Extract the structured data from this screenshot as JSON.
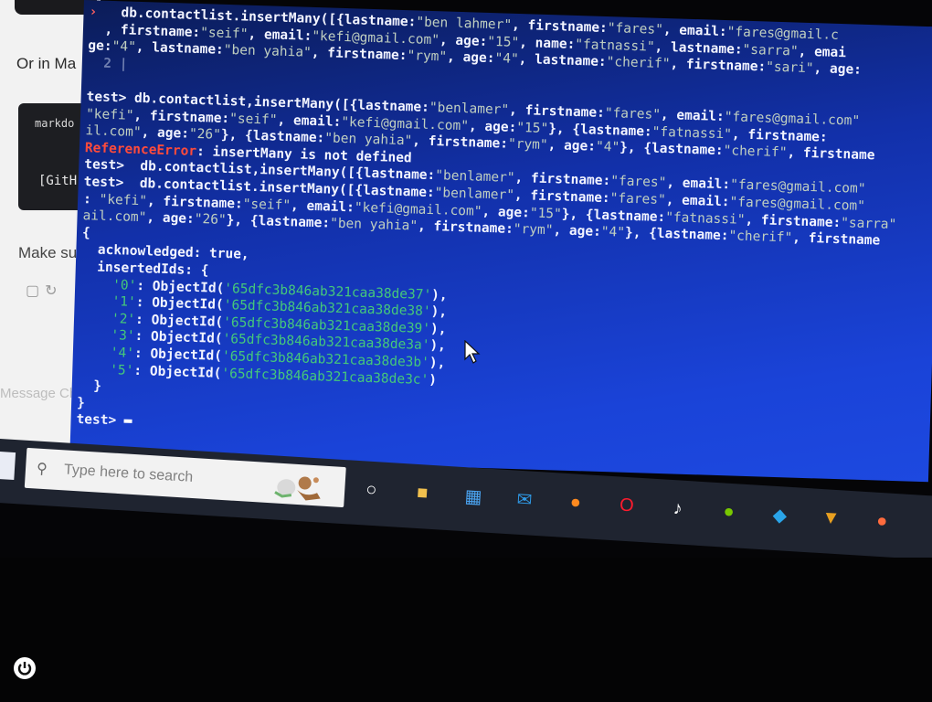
{
  "background_window": {
    "or_text": "Or in Ma",
    "markdown_text": "markdo",
    "github_text": "[GitH",
    "make_text": "Make su",
    "message_text": "Message Ch"
  },
  "terminal": {
    "lines": [
      {
        "segments": [
          {
            "t": "› ",
            "c": "caret"
          },
          {
            "t": "  db.contactlist.insertMany([{lastname:"
          },
          {
            "t": "\"ben lahmer\"",
            "c": "s"
          },
          {
            "t": ", firstname:"
          },
          {
            "t": "\"fares\"",
            "c": "s"
          },
          {
            "t": ", email:"
          },
          {
            "t": "\"fares@gmail.c",
            "c": "s"
          }
        ]
      },
      {
        "segments": [
          {
            "t": "  , firstname:"
          },
          {
            "t": "\"seif\"",
            "c": "s"
          },
          {
            "t": ", email:"
          },
          {
            "t": "\"kefi@gmail.com\"",
            "c": "s"
          },
          {
            "t": ", age:"
          },
          {
            "t": "\"15\"",
            "c": "s"
          },
          {
            "t": ", name:"
          },
          {
            "t": "\"fatnassi\"",
            "c": "s"
          },
          {
            "t": ", lastname:"
          },
          {
            "t": "\"sarra\"",
            "c": "s"
          },
          {
            "t": ", emai"
          }
        ]
      },
      {
        "segments": [
          {
            "t": "ge:"
          },
          {
            "t": "\"4\"",
            "c": "s"
          },
          {
            "t": ", lastname:"
          },
          {
            "t": "\"ben yahia\"",
            "c": "s"
          },
          {
            "t": ", firstname:"
          },
          {
            "t": "\"rym\"",
            "c": "s"
          },
          {
            "t": ", age:"
          },
          {
            "t": "\"4\"",
            "c": "s"
          },
          {
            "t": ", lastname:"
          },
          {
            "t": "\"cherif\"",
            "c": "s"
          },
          {
            "t": ", firstname:"
          },
          {
            "t": "\"sari\"",
            "c": "s"
          },
          {
            "t": ", age:"
          }
        ]
      },
      {
        "segments": [
          {
            "t": "  2 |",
            "c": "gutter"
          }
        ]
      },
      {
        "segments": [
          {
            "t": ""
          }
        ]
      },
      {
        "segments": [
          {
            "t": "test> db.contactlist,insertMany([{lastname:"
          },
          {
            "t": "\"benlamer\"",
            "c": "s"
          },
          {
            "t": ", firstname:"
          },
          {
            "t": "\"fares\"",
            "c": "s"
          },
          {
            "t": ", email:"
          },
          {
            "t": "\"fares@gmail.com\"",
            "c": "s"
          }
        ]
      },
      {
        "segments": [
          {
            "t": "\"kefi\"",
            "c": "s"
          },
          {
            "t": ", firstname:"
          },
          {
            "t": "\"seif\"",
            "c": "s"
          },
          {
            "t": ", email:"
          },
          {
            "t": "\"kefi@gmail.com\"",
            "c": "s"
          },
          {
            "t": ", age:"
          },
          {
            "t": "\"15\"",
            "c": "s"
          },
          {
            "t": "}, {lastname:"
          },
          {
            "t": "\"fatnassi\"",
            "c": "s"
          },
          {
            "t": ", firstname:"
          }
        ]
      },
      {
        "segments": [
          {
            "t": "il.com\"",
            "c": "s"
          },
          {
            "t": ", age:"
          },
          {
            "t": "\"26\"",
            "c": "s"
          },
          {
            "t": "}, {lastname:"
          },
          {
            "t": "\"ben yahia\"",
            "c": "s"
          },
          {
            "t": ", firstname:"
          },
          {
            "t": "\"rym\"",
            "c": "s"
          },
          {
            "t": ", age:"
          },
          {
            "t": "\"4\"",
            "c": "s"
          },
          {
            "t": "}, {lastname:"
          },
          {
            "t": "\"cherif\"",
            "c": "s"
          },
          {
            "t": ", firstname"
          }
        ]
      },
      {
        "segments": [
          {
            "t": "ReferenceError",
            "c": "err"
          },
          {
            "t": ": insertMany is not defined"
          }
        ]
      },
      {
        "segments": [
          {
            "t": "test>  db.contactlist,insertMany([{lastname:"
          },
          {
            "t": "\"benlamer\"",
            "c": "s"
          },
          {
            "t": ", firstname:"
          },
          {
            "t": "\"fares\"",
            "c": "s"
          },
          {
            "t": ", email:"
          },
          {
            "t": "\"fares@gmail.com\"",
            "c": "s"
          }
        ]
      },
      {
        "segments": [
          {
            "t": "test>  db.contactlist.insertMany([{lastname:"
          },
          {
            "t": "\"benlamer\"",
            "c": "s"
          },
          {
            "t": ", firstname:"
          },
          {
            "t": "\"fares\"",
            "c": "s"
          },
          {
            "t": ", email:"
          },
          {
            "t": "\"fares@gmail.com\"",
            "c": "s"
          }
        ]
      },
      {
        "segments": [
          {
            "t": ": "
          },
          {
            "t": "\"kefi\"",
            "c": "s"
          },
          {
            "t": ", firstname:"
          },
          {
            "t": "\"seif\"",
            "c": "s"
          },
          {
            "t": ", email:"
          },
          {
            "t": "\"kefi@gmail.com\"",
            "c": "s"
          },
          {
            "t": ", age:"
          },
          {
            "t": "\"15\"",
            "c": "s"
          },
          {
            "t": "}, {lastname:"
          },
          {
            "t": "\"fatnassi\"",
            "c": "s"
          },
          {
            "t": ", firstname:"
          },
          {
            "t": "\"sarra\"",
            "c": "s"
          }
        ]
      },
      {
        "segments": [
          {
            "t": "ail.com\"",
            "c": "s"
          },
          {
            "t": ", age:"
          },
          {
            "t": "\"26\"",
            "c": "s"
          },
          {
            "t": "}, {lastname:"
          },
          {
            "t": "\"ben yahia\"",
            "c": "s"
          },
          {
            "t": ", firstname:"
          },
          {
            "t": "\"rym\"",
            "c": "s"
          },
          {
            "t": ", age:"
          },
          {
            "t": "\"4\"",
            "c": "s"
          },
          {
            "t": "}, {lastname:"
          },
          {
            "t": "\"cherif\"",
            "c": "s"
          },
          {
            "t": ", firstname"
          }
        ]
      },
      {
        "segments": [
          {
            "t": "{"
          }
        ]
      },
      {
        "segments": [
          {
            "t": "  acknowledged: true,"
          }
        ]
      },
      {
        "segments": [
          {
            "t": "  insertedIds: {"
          }
        ]
      },
      {
        "segments": [
          {
            "t": "    "
          },
          {
            "t": "'0'",
            "c": "g"
          },
          {
            "t": ": ObjectId("
          },
          {
            "t": "'65dfc3b846ab321caa38de37'",
            "c": "g"
          },
          {
            "t": "),"
          }
        ]
      },
      {
        "segments": [
          {
            "t": "    "
          },
          {
            "t": "'1'",
            "c": "g"
          },
          {
            "t": ": ObjectId("
          },
          {
            "t": "'65dfc3b846ab321caa38de38'",
            "c": "g"
          },
          {
            "t": "),"
          }
        ]
      },
      {
        "segments": [
          {
            "t": "    "
          },
          {
            "t": "'2'",
            "c": "g"
          },
          {
            "t": ": ObjectId("
          },
          {
            "t": "'65dfc3b846ab321caa38de39'",
            "c": "g"
          },
          {
            "t": "),"
          }
        ]
      },
      {
        "segments": [
          {
            "t": "    "
          },
          {
            "t": "'3'",
            "c": "g"
          },
          {
            "t": ": ObjectId("
          },
          {
            "t": "'65dfc3b846ab321caa38de3a'",
            "c": "g"
          },
          {
            "t": "),"
          }
        ]
      },
      {
        "segments": [
          {
            "t": "    "
          },
          {
            "t": "'4'",
            "c": "g"
          },
          {
            "t": ": ObjectId("
          },
          {
            "t": "'65dfc3b846ab321caa38de3b'",
            "c": "g"
          },
          {
            "t": "),"
          }
        ]
      },
      {
        "segments": [
          {
            "t": "    "
          },
          {
            "t": "'5'",
            "c": "g"
          },
          {
            "t": ": ObjectId("
          },
          {
            "t": "'65dfc3b846ab321caa38de3c'",
            "c": "g"
          },
          {
            "t": ")"
          }
        ]
      },
      {
        "segments": [
          {
            "t": "  }"
          }
        ]
      },
      {
        "segments": [
          {
            "t": "}"
          }
        ]
      },
      {
        "segments": [
          {
            "t": "test>"
          }
        ]
      }
    ]
  },
  "taskbar": {
    "search_placeholder": "Type here to search",
    "icons": [
      {
        "name": "task-view-icon",
        "glyph": "○",
        "color": "#ffffff"
      },
      {
        "name": "file-explorer-icon",
        "glyph": "■",
        "color": "#f2c14e"
      },
      {
        "name": "microsoft-store-icon",
        "glyph": "▦",
        "color": "#4aa3f0"
      },
      {
        "name": "mail-icon",
        "glyph": "✉",
        "color": "#2f9ae6"
      },
      {
        "name": "firefox-icon",
        "glyph": "●",
        "color": "#ff8a1f"
      },
      {
        "name": "opera-icon",
        "glyph": "O",
        "color": "#ff1b2d"
      },
      {
        "name": "tiktok-icon",
        "glyph": "♪",
        "color": "#ffffff"
      },
      {
        "name": "duolingo-icon",
        "glyph": "●",
        "color": "#78c800"
      },
      {
        "name": "app-icon",
        "glyph": "◆",
        "color": "#2aa4e8"
      },
      {
        "name": "medal-icon",
        "glyph": "▼",
        "color": "#e8a020"
      },
      {
        "name": "app-icon",
        "glyph": "●",
        "color": "#ff6b3d"
      }
    ]
  },
  "colors": {
    "terminal_top": "#0b1c57",
    "terminal_bottom": "#1d49e0",
    "string_color": "#c0cfc0",
    "objectid_color": "#45c87a",
    "error_color": "#ff4b3b",
    "taskbar_bg": "#1f2430"
  }
}
